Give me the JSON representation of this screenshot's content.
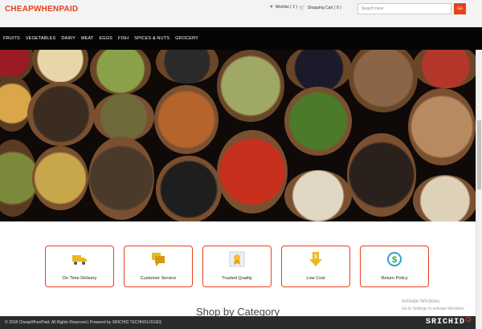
{
  "header": {
    "logo": "CHEAPWHENPAID",
    "wishlist": "Wishlist ( 2 )",
    "cart": "Shopping Cart ( 0 )",
    "search_placeholder": "Search here",
    "go_label": "Go",
    "heart_icon": "heart-icon",
    "cart_icon": "cart-icon"
  },
  "nav": [
    "FRUITS",
    "VEGETABLES",
    "DAIRY",
    "MEAT",
    "EGGS",
    "FISH",
    "SPICES & NUTS",
    "GROCERY"
  ],
  "features": [
    {
      "label": "On Time Delivery",
      "icon": "truck-icon"
    },
    {
      "label": "Customer Service",
      "icon": "chat-icon"
    },
    {
      "label": "Trusted Quality",
      "icon": "award-icon"
    },
    {
      "label": "Low Cost",
      "icon": "price-down-icon"
    },
    {
      "label": "Return Policy",
      "icon": "dollar-return-icon"
    }
  ],
  "section_title": "Shop by Category",
  "windows_notice": {
    "title": "Activate Windows",
    "subtitle": "Go to Settings to activate Windows."
  },
  "footer": {
    "copyright": "© 2018 CheapWhenPaid. All Rights Reserved | Powered by SRICHID TECHNOLOGIES",
    "brand": "SRICHID"
  },
  "colors": {
    "accent": "#e8401c",
    "nav_bg": "#050505",
    "footer_bg": "#2b2b2b"
  }
}
